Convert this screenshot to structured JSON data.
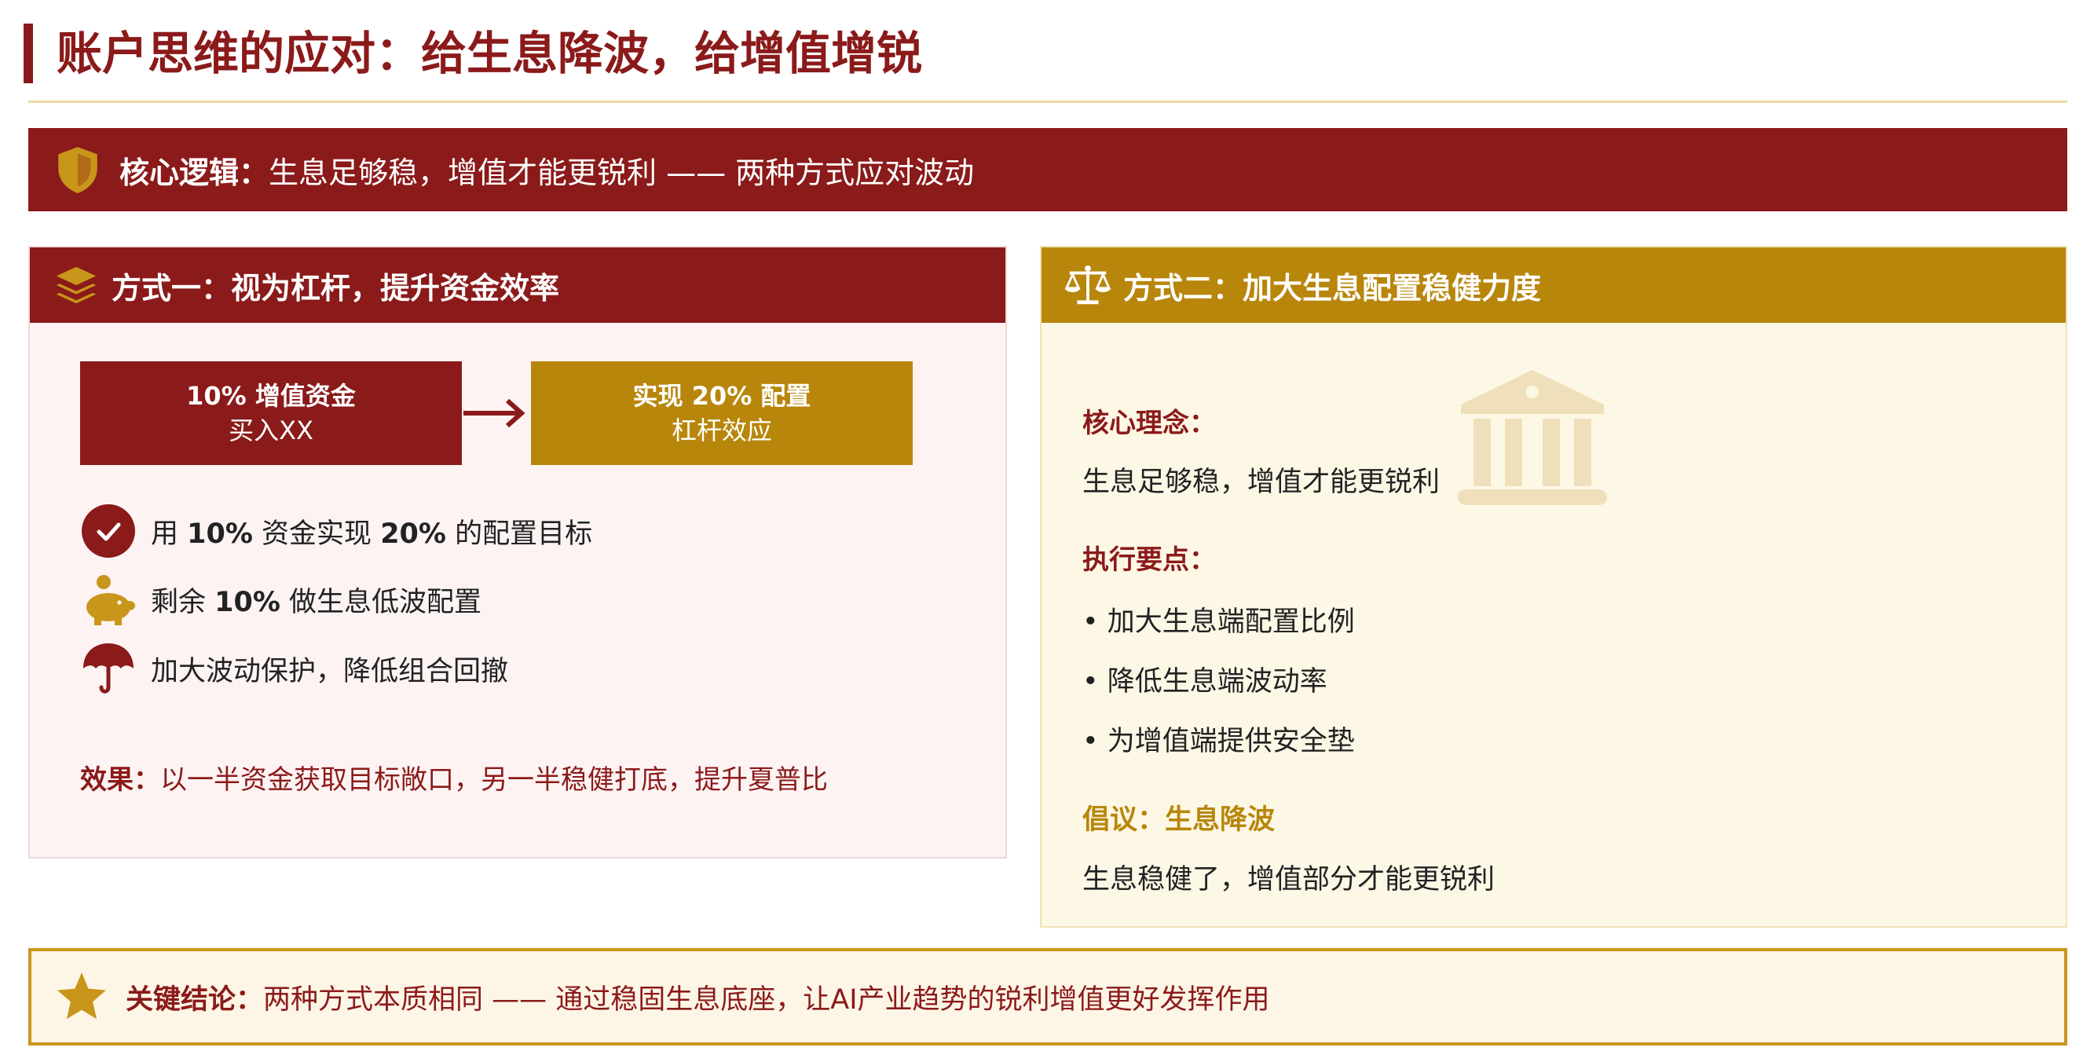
{
  "title": "账户思维的应对：给生息降波，给增值增锐",
  "core": {
    "label": "核心逻辑：",
    "text": "生息足够稳，增值才能更锐利 —— 两种方式应对波动",
    "icon": "shield-icon"
  },
  "method1": {
    "header": "方式一：视为杠杆，提升资金效率",
    "icon": "layers-icon",
    "box_a": {
      "line1": "10% 增值资金",
      "line2": "买入XX"
    },
    "box_b": {
      "line1": "实现 20% 配置",
      "line2": "杠杆效应"
    },
    "points": [
      {
        "icon": "check-circle-icon",
        "pre": "用 ",
        "b1": "10%",
        "mid": " 资金实现 ",
        "b2": "20%",
        "post": " 的配置目标"
      },
      {
        "icon": "piggy-bank-icon",
        "pre": "剩余 ",
        "b1": "10%",
        "post": " 做生息低波配置"
      },
      {
        "icon": "umbrella-icon",
        "text": "加大波动保护，降低组合回撤"
      }
    ],
    "effect_label": "效果：",
    "effect_text": "以一半资金获取目标敞口，另一半稳健打底，提升夏普比"
  },
  "method2": {
    "header": "方式二：加大生息配置稳健力度",
    "icon": "balance-scale-icon",
    "decor_icon": "bank-icon",
    "concept_label": "核心理念：",
    "concept_text": "生息足够稳，增值才能更锐利",
    "points_label": "执行要点：",
    "points": [
      "• 加大生息端配置比例",
      "• 降低生息端波动率",
      "• 为增值端提供安全垫"
    ],
    "advice_label": "倡议：生息降波",
    "advice_text": "生息稳健了，增值部分才能更锐利"
  },
  "conclusion": {
    "label": "关键结论：",
    "text": "两种方式本质相同 —— 通过稳固生息底座，让AI产业趋势的锐利增值更好发挥作用",
    "icon": "star-icon"
  },
  "colors": {
    "primary": "#8B1A1A",
    "gold": "#B8860B",
    "pink_bg": "#fdf3f3",
    "cream_bg": "#fdf7e6"
  }
}
